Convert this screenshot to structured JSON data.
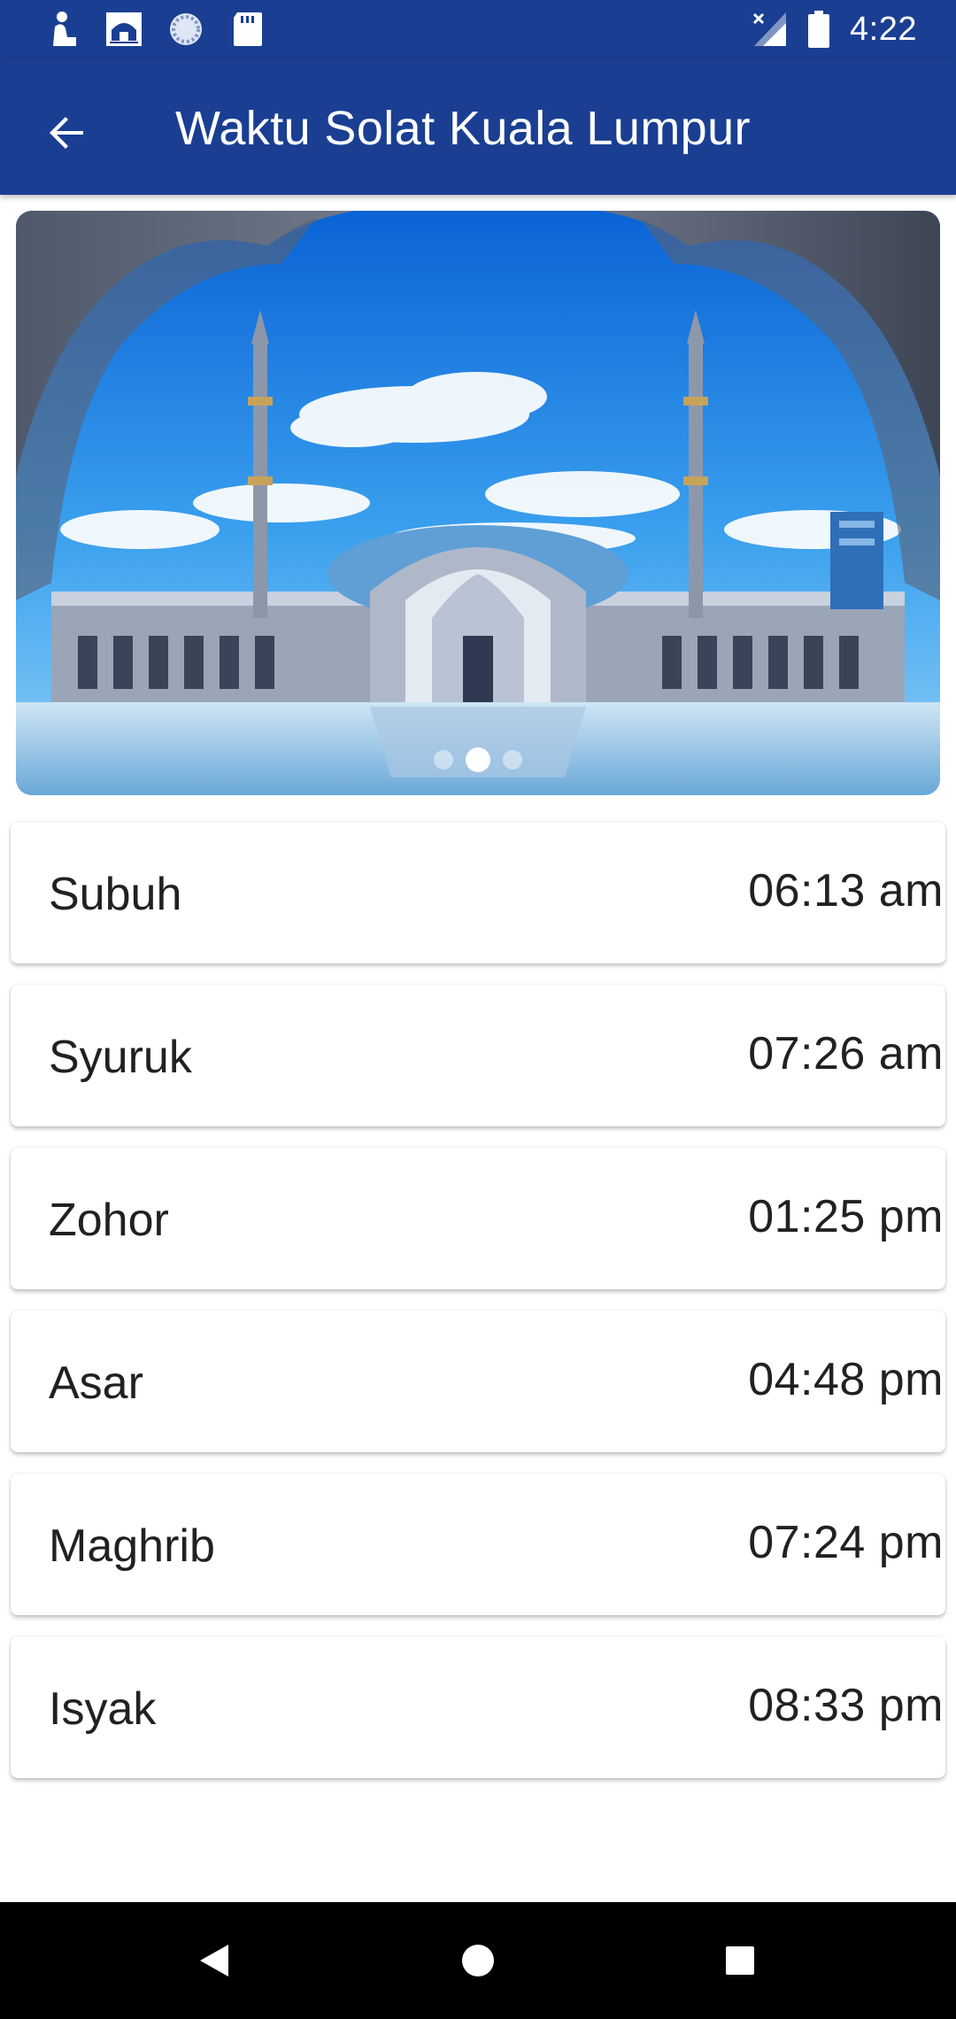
{
  "status_bar": {
    "time": "4:22",
    "left_icons": [
      "prayer-person-icon",
      "mosque-icon",
      "sync-circle-icon",
      "sd-card-icon"
    ],
    "right_icons": [
      "signal-no-connection-icon",
      "battery-icon"
    ],
    "bar_color": "#1a3f92"
  },
  "app_bar": {
    "title": "Waktu Solat Kuala Lumpur",
    "back_icon": "arrow-left-icon",
    "color": "#1a3f92"
  },
  "banner": {
    "description_icon": "mosque-photo",
    "page_count": 3,
    "active_page": 2
  },
  "prayers": [
    {
      "name": "Subuh",
      "time": "06:13 am"
    },
    {
      "name": "Syuruk",
      "time": "07:26 am"
    },
    {
      "name": "Zohor",
      "time": "01:25 pm"
    },
    {
      "name": "Asar",
      "time": "04:48 pm"
    },
    {
      "name": "Maghrib",
      "time": "07:24 pm"
    },
    {
      "name": "Isyak",
      "time": "08:33 pm"
    }
  ],
  "nav_bar": {
    "icons": [
      "nav-back-icon",
      "nav-home-icon",
      "nav-recents-icon"
    ]
  }
}
